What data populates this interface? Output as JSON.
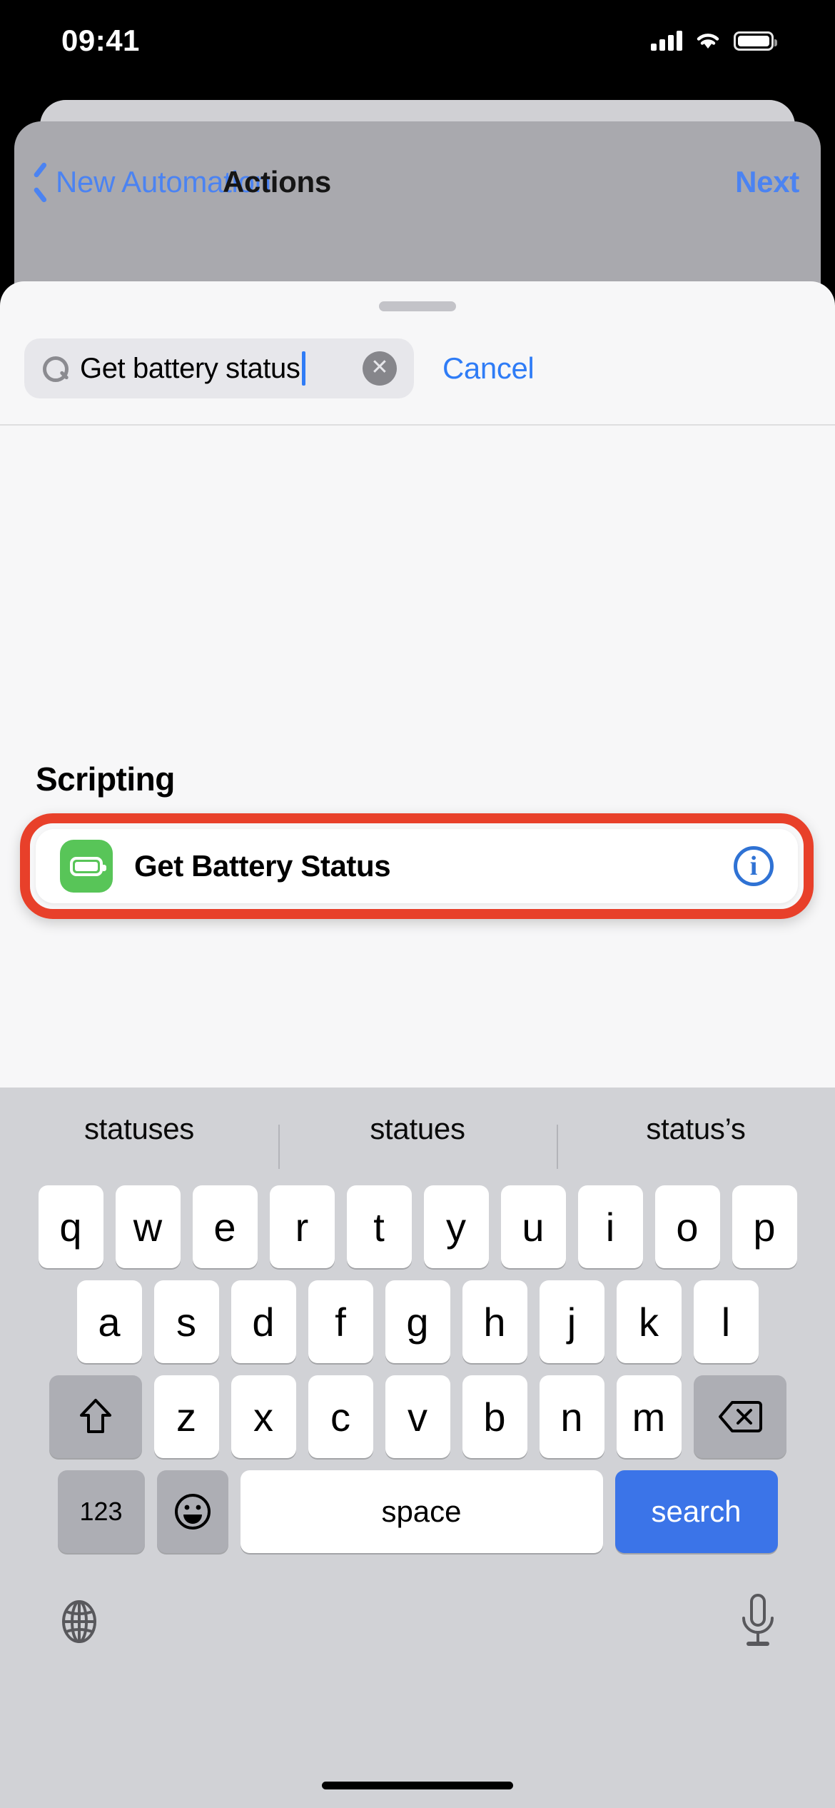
{
  "status_bar": {
    "time": "09:41",
    "cellular_icon": "signal-bars-icon",
    "wifi_icon": "wifi-icon",
    "battery_icon": "battery-icon"
  },
  "nav_bar": {
    "back_icon": "chevron-left-icon",
    "back_label": "New Automation",
    "title": "Actions",
    "next_label": "Next"
  },
  "sheet": {
    "grabber": "sheet-grabber",
    "search": {
      "icon": "search-icon",
      "value": "Get battery status",
      "placeholder": "Search",
      "clear_icon": "clear-x-icon",
      "clear_glyph": "✕",
      "cancel_label": "Cancel"
    },
    "results": {
      "section_title": "Scripting",
      "items": [
        {
          "icon": "battery-icon",
          "icon_color": "#58c558",
          "label": "Get Battery Status",
          "info_icon": "info-circle-icon",
          "info_glyph": "i",
          "highlighted": true,
          "highlight_color": "#e8402a"
        }
      ]
    }
  },
  "keyboard": {
    "suggestions": [
      "statuses",
      "statues",
      "status’s"
    ],
    "row1": [
      "q",
      "w",
      "e",
      "r",
      "t",
      "y",
      "u",
      "i",
      "o",
      "p"
    ],
    "row2": [
      "a",
      "s",
      "d",
      "f",
      "g",
      "h",
      "j",
      "k",
      "l"
    ],
    "row3": {
      "shift_icon": "shift-arrow-icon",
      "letters": [
        "z",
        "x",
        "c",
        "v",
        "b",
        "n",
        "m"
      ],
      "delete_icon": "backspace-icon"
    },
    "row4": {
      "numbers_label": "123",
      "emoji_icon": "emoji-smiley-icon",
      "space_label": "space",
      "return_label": "search",
      "return_color": "#3b74e8"
    },
    "bottom": {
      "globe_icon": "globe-icon",
      "mic_icon": "microphone-icon"
    }
  },
  "home_indicator": "home-indicator"
}
